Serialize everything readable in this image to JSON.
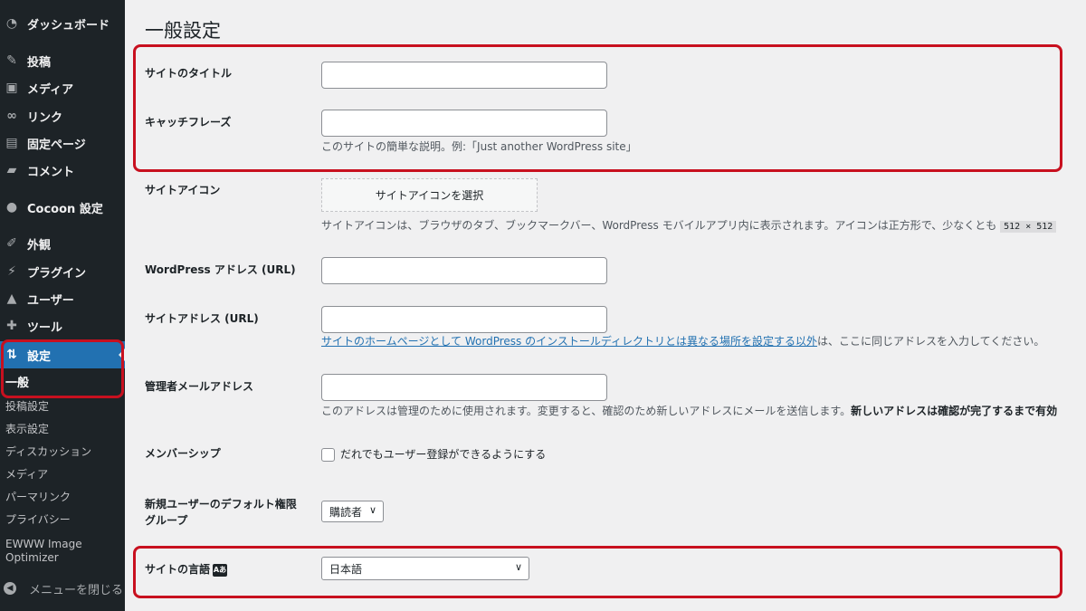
{
  "sidebar": {
    "items": [
      {
        "icon": "dashboard-icon",
        "glyph": "◔",
        "label": "ダッシュボード"
      },
      {
        "icon": "pin-icon",
        "glyph": "✎",
        "label": "投稿"
      },
      {
        "icon": "media-icon",
        "glyph": "▣",
        "label": "メディア"
      },
      {
        "icon": "link-icon",
        "glyph": "∞",
        "label": "リンク"
      },
      {
        "icon": "page-icon",
        "glyph": "▤",
        "label": "固定ページ"
      },
      {
        "icon": "comment-icon",
        "glyph": "▰",
        "label": "コメント"
      },
      {
        "icon": "cocoon-icon",
        "glyph": "●",
        "label": "Cocoon 設定"
      },
      {
        "icon": "appearance-icon",
        "glyph": "✐",
        "label": "外観"
      },
      {
        "icon": "plugin-icon",
        "glyph": "⚡",
        "label": "プラグイン"
      },
      {
        "icon": "user-icon",
        "glyph": "▲",
        "label": "ユーザー"
      },
      {
        "icon": "tool-icon",
        "glyph": "✚",
        "label": "ツール"
      },
      {
        "icon": "settings-icon",
        "glyph": "⇅",
        "label": "設定"
      }
    ],
    "submenu": [
      {
        "label": "一般"
      },
      {
        "label": "投稿設定"
      },
      {
        "label": "表示設定"
      },
      {
        "label": "ディスカッション"
      },
      {
        "label": "メディア"
      },
      {
        "label": "パーマリンク"
      },
      {
        "label": "プライバシー"
      },
      {
        "label": "EWWW Image"
      },
      {
        "label": "Optimizer"
      }
    ],
    "collapse_label": "メニューを閉じる"
  },
  "page": {
    "title": "一般設定",
    "fields": {
      "site_title": {
        "label": "サイトのタイトル",
        "value": ""
      },
      "tagline": {
        "label": "キャッチフレーズ",
        "value": "",
        "desc": "このサイトの簡単な説明。例:「Just another WordPress site」"
      },
      "site_icon": {
        "label": "サイトアイコン",
        "button": "サイトアイコンを選択",
        "desc": "サイトアイコンは、ブラウザのタブ、ブックマークバー、WordPress モバイルアプリ内に表示されます。アイコンは正方形で、少なくとも",
        "code": "512 × 512"
      },
      "wp_address": {
        "label": "WordPress アドレス (URL)",
        "value": ""
      },
      "site_address": {
        "label": "サイトアドレス (URL)",
        "value": "",
        "desc_link": "サイトのホームページとして WordPress のインストールディレクトリとは異なる場所を設定する以外",
        "desc_rest": "は、ここに同じアドレスを入力してください。"
      },
      "admin_email": {
        "label": "管理者メールアドレス",
        "value": "",
        "desc": "このアドレスは管理のために使用されます。変更すると、確認のため新しいアドレスにメールを送信します。",
        "desc_bold": "新しいアドレスは確認が完了するまで有効"
      },
      "membership": {
        "label": "メンバーシップ",
        "checkbox_label": "だれでもユーザー登録ができるようにする",
        "checked": false
      },
      "default_role": {
        "label_line1": "新規ユーザーのデフォルト権限",
        "label_line2": "グループ",
        "value": "購読者"
      },
      "site_language": {
        "label": "サイトの言語",
        "badge": "Aあ",
        "value": "日本語"
      }
    }
  },
  "colors": {
    "sidebar_bg": "#1d2327",
    "active": "#2271b1",
    "highlight": "#c8101f",
    "page_bg": "#f0f0f1"
  }
}
